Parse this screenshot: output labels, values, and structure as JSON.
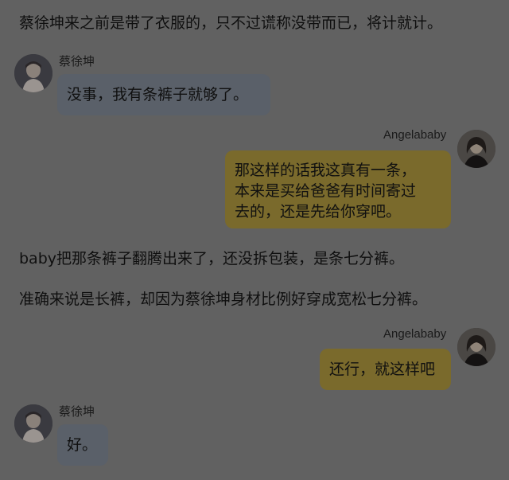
{
  "narration": [
    "蔡徐坤来之前是带了衣服的，只不过谎称没带而已，将计就计。",
    "baby把那条裤子翻腾出来了，还没拆包装，是条七分裤。",
    "准确来说是长裤，却因为蔡徐坤身材比例好穿成宽松七分裤。"
  ],
  "messages": [
    {
      "sender": "蔡徐坤",
      "side": "left",
      "text": "没事，我有条裤子就够了。"
    },
    {
      "sender": "Angelababy",
      "side": "right",
      "text": "那这样的话我这真有一条，\n本来是买给爸爸有时间寄过\n去的，还是先给你穿吧。"
    },
    {
      "sender": "Angelababy",
      "side": "right",
      "text": "还行，就这样吧"
    },
    {
      "sender": "蔡徐坤",
      "side": "left",
      "text": "好。"
    }
  ],
  "colors": {
    "background": "#616161",
    "left_bubble": "#5a6069",
    "right_bubble": "#7a6a2c"
  },
  "icons": {
    "male_avatar": "male-avatar-icon",
    "female_avatar": "female-avatar-icon"
  }
}
